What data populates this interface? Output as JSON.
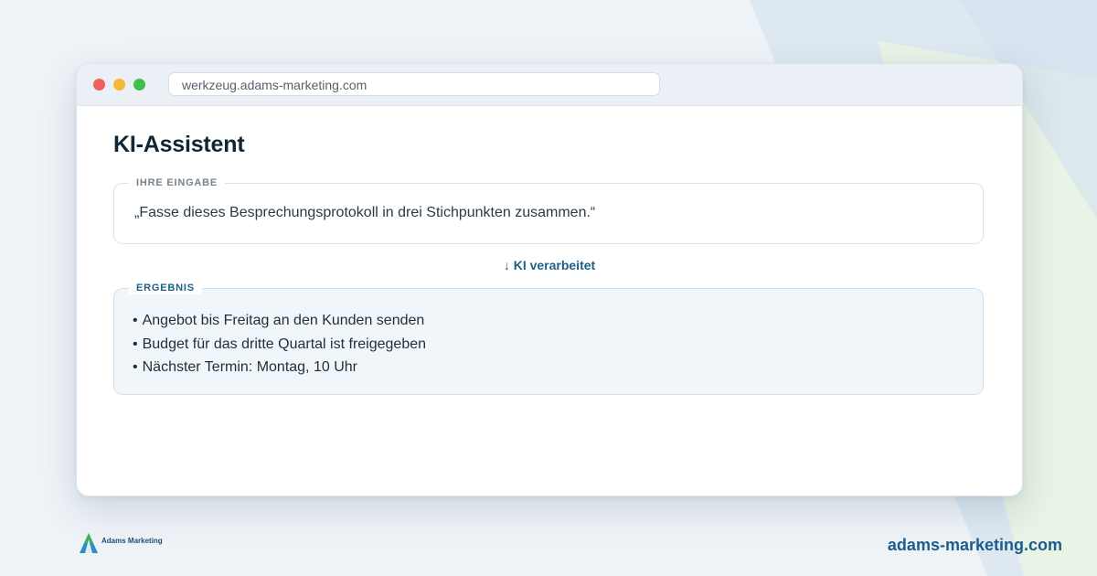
{
  "browser": {
    "url": "werkzeug.adams-marketing.com"
  },
  "page": {
    "title": "KI-Assistent",
    "input_label": "IHRE EINGABE",
    "input_text": "„Fasse dieses Besprechungsprotokoll in drei Stichpunkten zusammen.“",
    "processing_label": "↓ KI verarbeitet",
    "result_label": "ERGEBNIS",
    "result_items": [
      "Angebot bis Freitag an den Kunden senden",
      "Budget für das dritte Quartal ist freigegeben",
      "Nächster Termin: Montag, 10 Uhr"
    ],
    "bullet": "•"
  },
  "footer": {
    "logo_text": "Adams Marketing",
    "url": "adams-marketing.com"
  },
  "colors": {
    "accent": "#1e5f88",
    "title": "#0f2733",
    "dot_red": "#f0605c",
    "dot_yellow": "#f6b83a",
    "dot_green": "#3cc04b"
  }
}
